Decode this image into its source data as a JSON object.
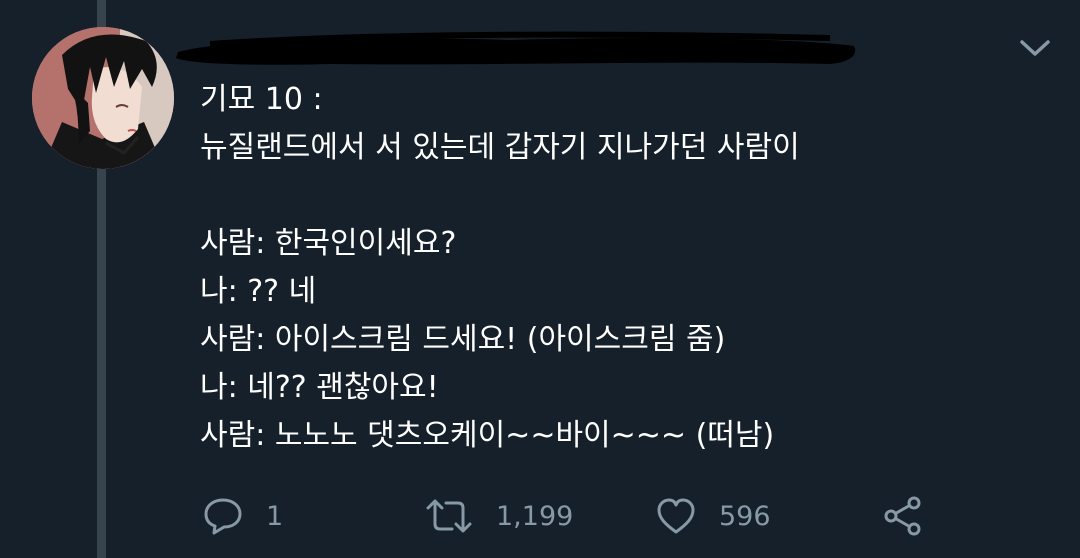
{
  "tweet": {
    "lines": [
      "기묘 10 :",
      "뉴질랜드에서 서 있는데 갑자기 지나가던 사람이",
      "",
      "사람: 한국인이세요?",
      "나: ?? 네",
      "사람: 아이스크림 드세요! (아이스크림 줌)",
      "나: 네?? 괜찮아요!",
      "사람: 노노노 댓츠오케이~~바이~~~ (떠남)"
    ]
  },
  "actions": {
    "reply_count": "1",
    "retweet_count": "1,199",
    "like_count": "596"
  },
  "icons": {
    "reply": "reply-icon",
    "retweet": "retweet-icon",
    "like": "heart-icon",
    "share": "share-icon",
    "caret": "chevron-down-icon"
  },
  "colors": {
    "background": "#15202b",
    "thread_line": "#38444d",
    "icon": "#8899a6",
    "text": "#ffffff"
  }
}
